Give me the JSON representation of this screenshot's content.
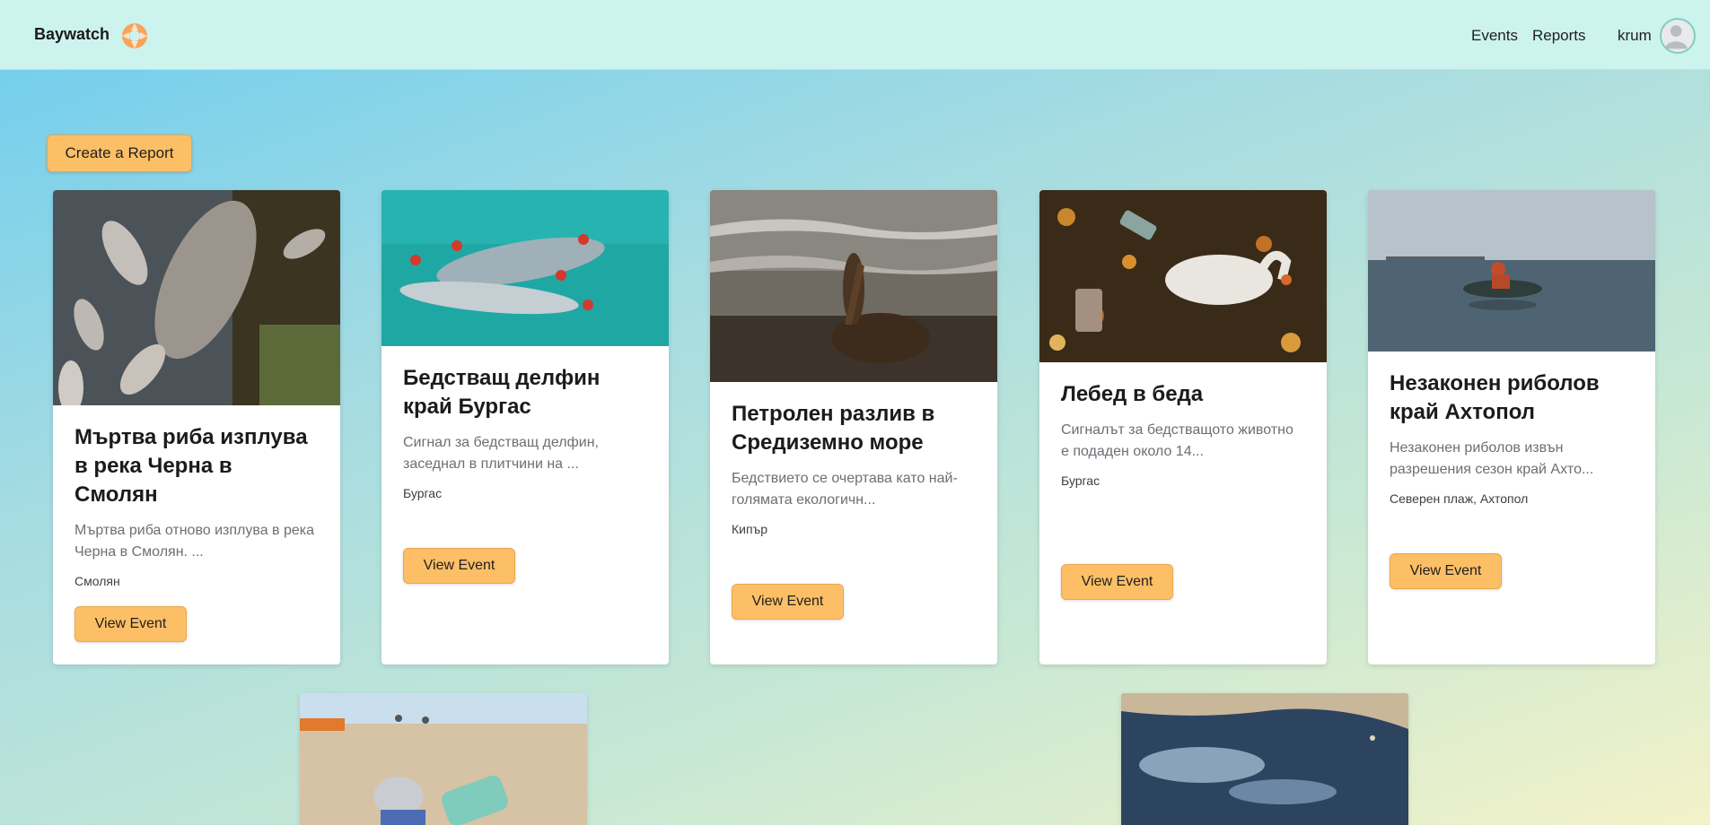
{
  "navbar": {
    "brand": "Baywatch",
    "links": {
      "events": "Events",
      "reports": "Reports"
    },
    "user": "krum"
  },
  "actions": {
    "create_report": "Create a Report"
  },
  "cards": [
    {
      "title": "Мъртва риба изплува в река Черна в Смолян",
      "description": "Мъртва риба отново изплува в река Черна в Смолян. ...",
      "location": "Смолян",
      "button": "View Event"
    },
    {
      "title": "Бедстващ делфин край Бургас",
      "description": "Сигнал за бедстващ делфин, заседнал в плитчини на ...",
      "location": "Бургас",
      "button": "View Event"
    },
    {
      "title": "Петролен разлив в Средиземно море",
      "description": "Бедствието се очертава като най-голямата екологичн...",
      "location": "Кипър",
      "button": "View Event"
    },
    {
      "title": "Лебед в беда",
      "description": "Сигналът за бедстващото животно е подаден около 14...",
      "location": "Бургас",
      "button": "View Event"
    },
    {
      "title": "Незаконен риболов край Ахтопол",
      "description": "Незаконен риболов извън разрешения сезон край Ахто...",
      "location": "Северен плаж, Ахтопол",
      "button": "View Event"
    }
  ]
}
